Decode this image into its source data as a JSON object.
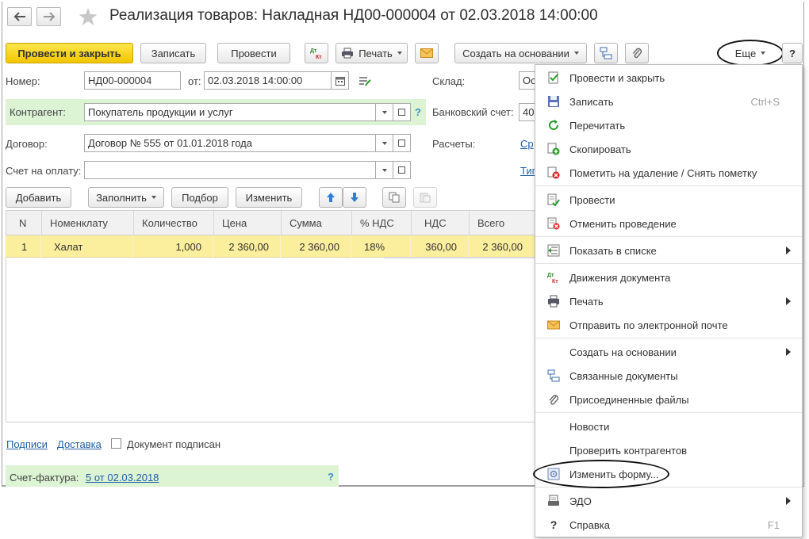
{
  "window": {
    "title": "Реализация товаров: Накладная НД00-000004 от 02.03.2018 14:00:00"
  },
  "toolbar": {
    "post_and_close": "Провести и закрыть",
    "save": "Записать",
    "post": "Провести",
    "dtkt": "Дт Кт",
    "print": "Печать",
    "create_based_on": "Создать на основании",
    "more": "Еще",
    "help": "?"
  },
  "fields": {
    "number_label": "Номер:",
    "number_value": "НД00-000004",
    "from_label": "от:",
    "date_value": "02.03.2018 14:00:00",
    "warehouse_label": "Склад:",
    "warehouse_value": "Ос",
    "counterparty_label": "Контрагент:",
    "counterparty_value": "Покупатель продукции и услуг",
    "bank_account_label": "Банковский счет:",
    "bank_account_value": "40",
    "contract_label": "Договор:",
    "contract_value": "Договор № 555 от 01.01.2018 года",
    "settlements_label": "Расчеты:",
    "settlements_link": "Ср",
    "invoice_label": "Счет на оплату:",
    "invoice_value": "",
    "type_link": "Тип"
  },
  "table_toolbar": {
    "add": "Добавить",
    "fill": "Заполнить",
    "select": "Подбор",
    "change": "Изменить"
  },
  "table": {
    "columns": [
      "N",
      "Номенклату",
      "Количество",
      "Цена",
      "Сумма",
      "% НДС",
      "НДС",
      "Всего"
    ],
    "rows": [
      [
        "1",
        "Халат",
        "1,000",
        "2 360,00",
        "2 360,00",
        "18%",
        "360,00",
        "2 360,00"
      ]
    ]
  },
  "footer": {
    "signatures_link": "Подписи",
    "delivery_link": "Доставка",
    "signed_label": "Документ подписан",
    "invoice_label": "Счет-фактура:",
    "invoice_link": "5 от 02.03.2018",
    "help": "?"
  },
  "menu": {
    "items": [
      {
        "label": "Провести и закрыть",
        "icon": "post-close-icon",
        "shortcut": "",
        "submenu": false
      },
      {
        "label": "Записать",
        "icon": "save-disk-icon",
        "shortcut": "Ctrl+S",
        "submenu": false
      },
      {
        "label": "Перечитать",
        "icon": "refresh-icon",
        "shortcut": "",
        "submenu": false
      },
      {
        "label": "Скопировать",
        "icon": "copy-icon",
        "shortcut": "",
        "submenu": false
      },
      {
        "label": "Пометить на удаление / Снять пометку",
        "icon": "mark-delete-icon",
        "shortcut": "",
        "submenu": false
      },
      {
        "label": "Провести",
        "icon": "post-icon",
        "shortcut": "",
        "submenu": false
      },
      {
        "label": "Отменить проведение",
        "icon": "unpost-icon",
        "shortcut": "",
        "submenu": false
      },
      {
        "label": "Показать в списке",
        "icon": "show-in-list-icon",
        "shortcut": "",
        "submenu": true
      },
      {
        "label": "Движения документа",
        "icon": "dtkt-icon",
        "shortcut": "",
        "submenu": false
      },
      {
        "label": "Печать",
        "icon": "printer-icon",
        "shortcut": "",
        "submenu": true
      },
      {
        "label": "Отправить по электронной почте",
        "icon": "envelope-icon",
        "shortcut": "",
        "submenu": false
      },
      {
        "label": "Создать на основании",
        "icon": "",
        "shortcut": "",
        "submenu": true
      },
      {
        "label": "Связанные документы",
        "icon": "linked-docs-icon",
        "shortcut": "",
        "submenu": false
      },
      {
        "label": "Присоединенные файлы",
        "icon": "paperclip-icon",
        "shortcut": "",
        "submenu": false
      },
      {
        "label": "Новости",
        "icon": "",
        "shortcut": "",
        "submenu": false
      },
      {
        "label": "Проверить контрагентов",
        "icon": "",
        "shortcut": "",
        "submenu": false
      },
      {
        "label": "Изменить форму...",
        "icon": "change-form-icon",
        "shortcut": "",
        "submenu": false
      },
      {
        "label": "ЭДО",
        "icon": "edo-icon",
        "shortcut": "",
        "submenu": true
      },
      {
        "label": "Справка",
        "icon": "help-icon",
        "shortcut": "F1",
        "submenu": false
      }
    ]
  },
  "colors": {
    "primary_button": "#f5cf0b",
    "selected_row": "#fbee9d",
    "green_band": "#dcf3d4",
    "link": "#1f5fa8"
  }
}
